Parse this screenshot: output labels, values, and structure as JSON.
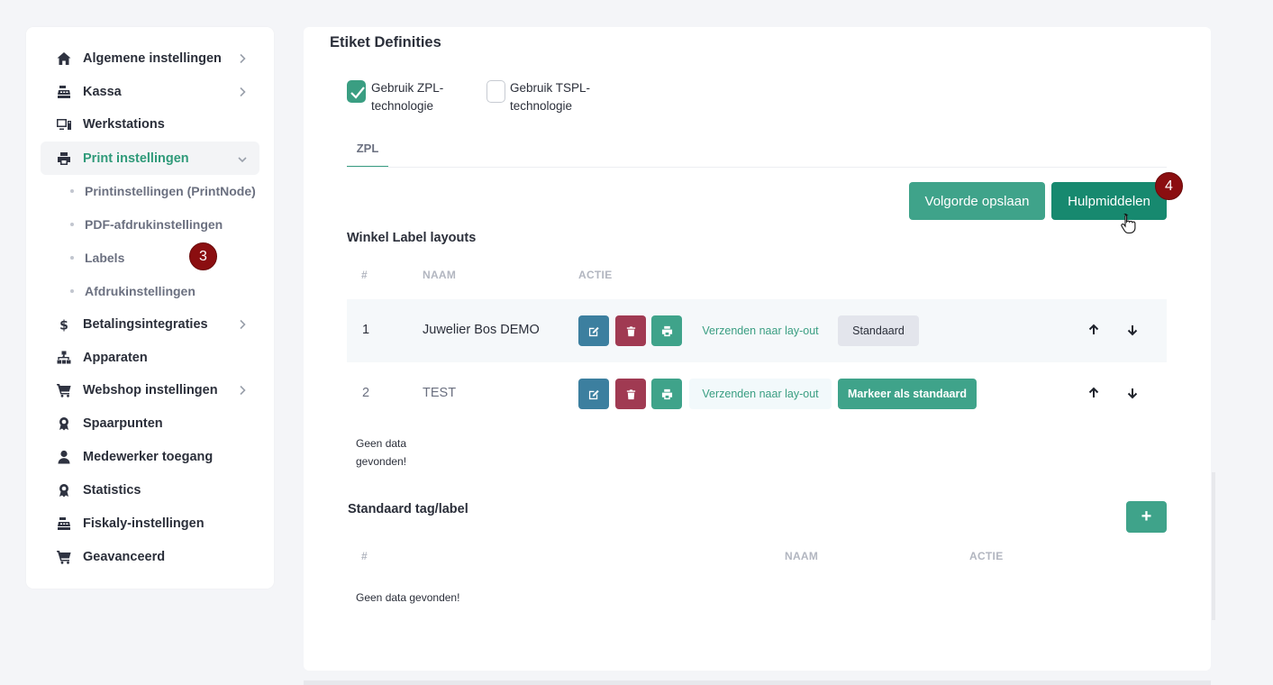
{
  "sidebar": {
    "items": [
      {
        "label": "Algemene instellingen",
        "icon": "home-icon",
        "chevron": "right"
      },
      {
        "label": "Kassa",
        "icon": "cash-register-icon",
        "chevron": "right"
      },
      {
        "label": "Werkstations",
        "icon": "workstation-icon",
        "chevron": ""
      },
      {
        "label": "Print instellingen",
        "icon": "printer-icon",
        "chevron": "down",
        "active": true
      },
      {
        "label": "Betalingsintegraties",
        "icon": "dollar-icon",
        "chevron": "right"
      },
      {
        "label": "Apparaten",
        "icon": "network-icon",
        "chevron": ""
      },
      {
        "label": "Webshop instellingen",
        "icon": "cart-icon",
        "chevron": "right"
      },
      {
        "label": "Spaarpunten",
        "icon": "award-icon",
        "chevron": ""
      },
      {
        "label": "Medewerker toegang",
        "icon": "user-icon",
        "chevron": ""
      },
      {
        "label": "Statistics",
        "icon": "award-icon",
        "chevron": ""
      },
      {
        "label": "Fiskaly-instellingen",
        "icon": "cash-register-icon",
        "chevron": ""
      },
      {
        "label": "Geavanceerd",
        "icon": "cart-icon",
        "chevron": ""
      }
    ],
    "sub_items": [
      {
        "label": "Printinstellingen (PrintNode)"
      },
      {
        "label": "PDF-afdrukinstellingen"
      },
      {
        "label": "Labels"
      },
      {
        "label": "Afdrukinstellingen"
      }
    ]
  },
  "markers": {
    "labels_step": "3",
    "help_step": "4"
  },
  "main": {
    "title": "Etiket Definities",
    "zpl_checkbox": {
      "label": "Gebruik ZPL-technologie",
      "checked": true
    },
    "tspl_checkbox": {
      "label": "Gebruik TSPL-technologie",
      "checked": false
    },
    "tab": "ZPL",
    "save_order_label": "Volgorde opslaan",
    "tools_label": "Hulpmiddelen",
    "store_layouts": {
      "title": "Winkel Label layouts",
      "columns": [
        "#",
        "NAAM",
        "ACTIE"
      ],
      "rows": [
        {
          "num": "1",
          "name": "Juwelier Bos DEMO",
          "send_label": "Verzenden naar lay-out",
          "default_label": "Standaard"
        },
        {
          "num": "2",
          "name": "TEST",
          "send_label": "Verzenden naar lay-out",
          "default_label": "Markeer als standaard"
        }
      ],
      "no_data": "Geen data gevonden!"
    },
    "default_tag": {
      "title": "Standaard tag/label",
      "add_label": "+",
      "columns": [
        "#",
        "NAAM",
        "ACTIE"
      ],
      "no_data": "Geen data gevonden!"
    }
  },
  "colors": {
    "accent": "#3fa38a",
    "accent_dark": "#17896f",
    "edit": "#3c7f9f",
    "delete": "#a03a52",
    "marker": "#8b0e10"
  }
}
